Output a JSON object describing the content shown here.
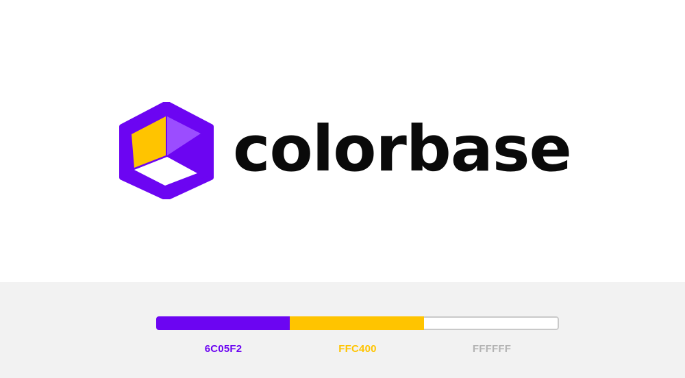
{
  "brand": {
    "wordmark": "colorbase",
    "logo_icon": "hexagon-cube-logo-icon"
  },
  "palette": {
    "swatches": [
      {
        "hex_label": "6C05F2",
        "color": "#6C05F2",
        "label_color": "#6C05F2"
      },
      {
        "hex_label": "FFC400",
        "color": "#FFC400",
        "label_color": "#FFC400"
      },
      {
        "hex_label": "FFFFFF",
        "color": "#FFFFFF",
        "label_color": "#B3B3B3"
      }
    ]
  },
  "colors": {
    "primary": "#6C05F2",
    "secondary": "#FFC400",
    "light_purple": "#9B4DFF",
    "wordmark": "#0A0A0A",
    "palette_background": "#F2F2F2"
  }
}
